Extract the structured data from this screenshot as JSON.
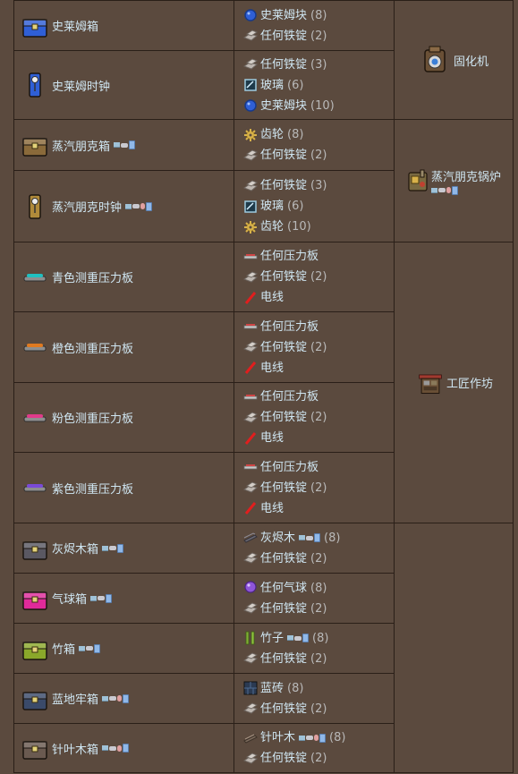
{
  "recipes": [
    {
      "result": "史莱姆箱",
      "icon": "blue-slime-chest-icon",
      "ingredients": [
        {
          "name": "史莱姆块",
          "count": "(8)",
          "icon": "slime-block-icon"
        },
        {
          "name": "任何铁锭",
          "count": "(2)",
          "icon": "iron-bar-icon"
        }
      ]
    },
    {
      "result": "史莱姆时钟",
      "icon": "slime-clock-icon",
      "ingredients": [
        {
          "name": "任何铁锭",
          "count": "(3)",
          "icon": "iron-bar-icon"
        },
        {
          "name": "玻璃",
          "count": "(6)",
          "icon": "glass-icon"
        },
        {
          "name": "史莱姆块",
          "count": "(10)",
          "icon": "slime-block-icon"
        }
      ]
    },
    {
      "result": "蒸汽朋克箱",
      "icon": "steampunk-chest-icon",
      "ingredients": [
        {
          "name": "齿轮",
          "count": "(8)",
          "icon": "cog-icon"
        },
        {
          "name": "任何铁锭",
          "count": "(2)",
          "icon": "iron-bar-icon"
        }
      ]
    },
    {
      "result": "蒸汽朋克时钟",
      "icon": "steampunk-clock-icon",
      "ingredients": [
        {
          "name": "任何铁锭",
          "count": "(3)",
          "icon": "iron-bar-icon"
        },
        {
          "name": "玻璃",
          "count": "(6)",
          "icon": "glass-icon"
        },
        {
          "name": "齿轮",
          "count": "(10)",
          "icon": "cog-icon"
        }
      ]
    },
    {
      "result": "青色测重压力板",
      "icon": "cyan-pressure-plate-icon",
      "ingredients": [
        {
          "name": "任何压力板",
          "count": "",
          "icon": "pressure-plate-icon"
        },
        {
          "name": "任何铁锭",
          "count": "(2)",
          "icon": "iron-bar-icon"
        },
        {
          "name": "电线",
          "count": "",
          "icon": "wire-icon"
        }
      ]
    },
    {
      "result": "橙色测重压力板",
      "icon": "orange-pressure-plate-icon",
      "ingredients": [
        {
          "name": "任何压力板",
          "count": "",
          "icon": "pressure-plate-icon"
        },
        {
          "name": "任何铁锭",
          "count": "(2)",
          "icon": "iron-bar-icon"
        },
        {
          "name": "电线",
          "count": "",
          "icon": "wire-icon"
        }
      ]
    },
    {
      "result": "粉色测重压力板",
      "icon": "pink-pressure-plate-icon",
      "ingredients": [
        {
          "name": "任何压力板",
          "count": "",
          "icon": "pressure-plate-icon"
        },
        {
          "name": "任何铁锭",
          "count": "(2)",
          "icon": "iron-bar-icon"
        },
        {
          "name": "电线",
          "count": "",
          "icon": "wire-icon"
        }
      ]
    },
    {
      "result": "紫色测重压力板",
      "icon": "purple-pressure-plate-icon",
      "ingredients": [
        {
          "name": "任何压力板",
          "count": "",
          "icon": "pressure-plate-icon"
        },
        {
          "name": "任何铁锭",
          "count": "(2)",
          "icon": "iron-bar-icon"
        },
        {
          "name": "电线",
          "count": "",
          "icon": "wire-icon"
        }
      ]
    },
    {
      "result": "灰烬木箱",
      "icon": "ash-wood-chest-icon",
      "ingredients": [
        {
          "name": "灰烬木",
          "count": "(8)",
          "icon": "ash-wood-icon"
        },
        {
          "name": "任何铁锭",
          "count": "(2)",
          "icon": "iron-bar-icon"
        }
      ]
    },
    {
      "result": "气球箱",
      "icon": "balloon-chest-icon",
      "ingredients": [
        {
          "name": "任何气球",
          "count": "(8)",
          "icon": "balloon-icon"
        },
        {
          "name": "任何铁锭",
          "count": "(2)",
          "icon": "iron-bar-icon"
        }
      ]
    },
    {
      "result": "竹箱",
      "icon": "bamboo-chest-icon",
      "ingredients": [
        {
          "name": "竹子",
          "count": "(8)",
          "icon": "bamboo-icon"
        },
        {
          "name": "任何铁锭",
          "count": "(2)",
          "icon": "iron-bar-icon"
        }
      ]
    },
    {
      "result": "蓝地牢箱",
      "icon": "blue-dungeon-chest-icon",
      "ingredients": [
        {
          "name": "蓝砖",
          "count": "(8)",
          "icon": "blue-brick-icon"
        },
        {
          "name": "任何铁锭",
          "count": "(2)",
          "icon": "iron-bar-icon"
        }
      ]
    },
    {
      "result": "针叶木箱",
      "icon": "boreal-wood-chest-icon",
      "ingredients": [
        {
          "name": "针叶木",
          "count": "(8)",
          "icon": "boreal-wood-icon"
        },
        {
          "name": "任何铁锭",
          "count": "(2)",
          "icon": "iron-bar-icon"
        }
      ]
    }
  ],
  "stations": {
    "solidifier": "固化机",
    "steampunk_boiler": "蒸汽朋克锅炉",
    "tinkerers_workshop": "工匠作坊"
  },
  "version_icons": [
    "pc-icon",
    "console-icon",
    "old-gen-icon",
    "mobile-icon"
  ],
  "colors": {
    "background": "#5b4a3e",
    "text": "#cfe6f2",
    "count": "#b9b9b9",
    "border": "#2a1f18"
  }
}
